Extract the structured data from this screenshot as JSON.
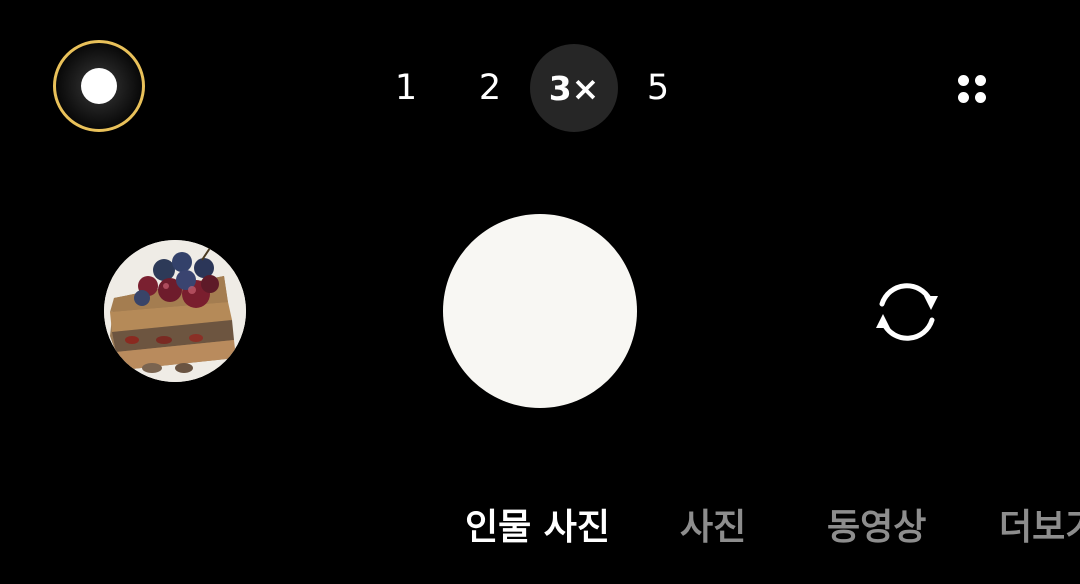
{
  "top_bar": {
    "effect_button": {
      "icon": "portrait-effect-icon",
      "ring_color": "#e9c15a"
    },
    "zoom_levels": [
      {
        "label": "1",
        "active": false
      },
      {
        "label": "2",
        "active": false
      },
      {
        "label": "3×",
        "active": true
      },
      {
        "label": "5",
        "active": false
      }
    ],
    "settings_icon": "grid-dots-icon"
  },
  "controls": {
    "gallery_thumbnail": "cake-photo-thumbnail",
    "shutter_color": "#f8f7f3",
    "switch_camera_icon": "switch-camera-icon"
  },
  "modes": [
    {
      "label": "인물 사진",
      "active": true
    },
    {
      "label": "사진",
      "active": false
    },
    {
      "label": "동영상",
      "active": false
    },
    {
      "label": "더보기",
      "active": false
    }
  ]
}
